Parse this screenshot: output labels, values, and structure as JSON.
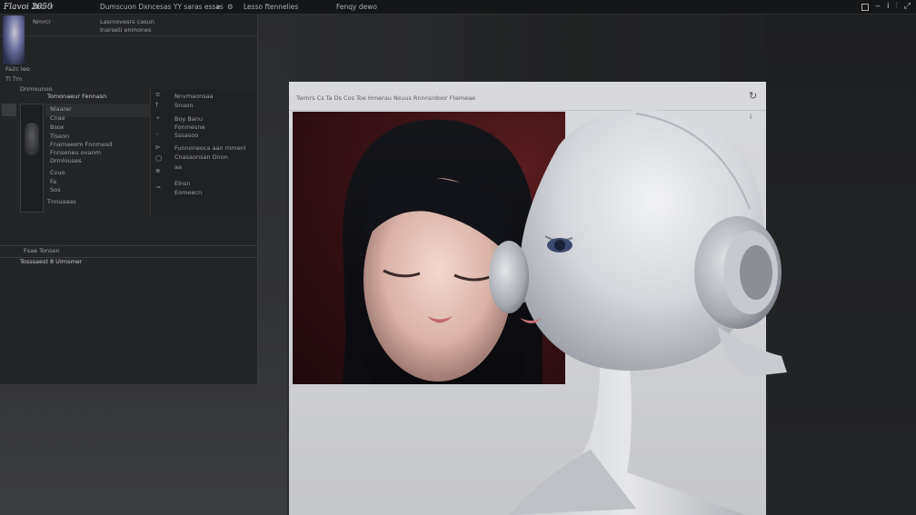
{
  "topbar": {
    "app_title": "Flavoi 2050",
    "item_1": "Nmrcr",
    "item_2": "Dumscuon Dxncesas YY saras essas",
    "item_3": "Lesso ftennelies",
    "item_4": "Fenqy dewo",
    "icons": [
      "pin-icon",
      "settings-icon",
      "window-icon",
      "minimize-icon",
      "info-icon",
      "sliders-icon",
      "expand-icon"
    ]
  },
  "left_panel": {
    "header_lines": [
      "Nmrcr",
      "Lasmovesrs casun",
      "Inarseti enmones"
    ],
    "meta_1": "Fa2c  Ieo",
    "meta_2": "Tl  Tm",
    "meta_3": "Dnmounoo",
    "section_title": "Tomonaeur Fennasn",
    "list_items": [
      "Nlaarer",
      "Cnae",
      "Bsox",
      "Tlseon",
      "Fnamaeem Fnnmesd",
      "Fnnseneu ovanm",
      "Drmlouses",
      "Cvuo",
      "Fa",
      "Sos",
      "Tnnuaaas"
    ],
    "sub_items": [
      "Nnvmaonsaa",
      "Snuon",
      "Boy Banu",
      "Fonmesne",
      "Sssasoo",
      "Funnoneoca aan rnmenl",
      "Cnasaonsan Dnon",
      "aa",
      "Elnsn",
      "Eomeecn"
    ],
    "footer_meta": "Fsae  Tonsen",
    "footer_title": "Tosssaest  8 Uimsmer"
  },
  "preview": {
    "title": "Twmrs Cs Ta Ds Cos Toe Hmerau Nsuus Rnnnsrdoor Ftemeae",
    "refresh_icon": "refresh-icon",
    "close_icon": "close-icon"
  },
  "colors": {
    "background": "#1f2022",
    "panel": "#242527",
    "preview_bg": "#d3d4d7",
    "photo_bg": "#2a0f12",
    "accent_text": "#c6c8ca"
  }
}
